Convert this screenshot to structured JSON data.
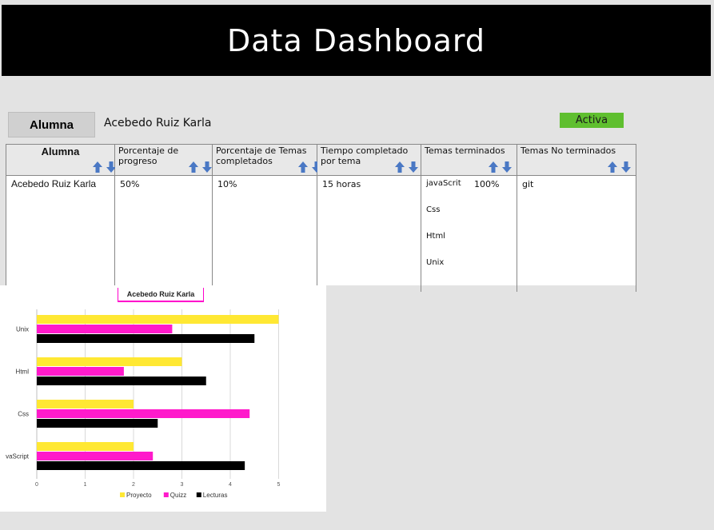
{
  "header": {
    "title": "Data Dashboard"
  },
  "student": {
    "button_label": "Alumna",
    "name": "Acebedo Ruiz Karla",
    "status": "Activa",
    "status_color": "#5fbf2f"
  },
  "table": {
    "headers": [
      "Alumna",
      "Porcentaje de progreso",
      "Porcentaje de Temas completados",
      "Tiempo completado por tema",
      "Temas terminados",
      "Temas No terminados"
    ],
    "row": {
      "alumna": "Acebedo Ruiz Karla",
      "progreso": "50%",
      "temas_completados": "10%",
      "tiempo": "15 horas",
      "temas_terminados": [
        "javaScrit",
        "Css",
        "Html",
        "Unix"
      ],
      "temas_terminados_pct": "100%",
      "temas_no_terminados": "git"
    },
    "sort_icons": [
      "arrow-up-icon",
      "arrow-down-icon"
    ],
    "sort_color": "#4a78c4"
  },
  "chart_data": {
    "type": "bar",
    "orientation": "horizontal",
    "title": "Acebedo Ruiz Karla",
    "categories": [
      "Unix",
      "Html",
      "Css",
      "vaScript"
    ],
    "series": [
      {
        "name": "Proyecto",
        "color": "#ffe833",
        "values": [
          5,
          3,
          2,
          2
        ]
      },
      {
        "name": "Quizz",
        "color": "#ff1acb",
        "values": [
          2.8,
          1.8,
          4.4,
          2.4
        ]
      },
      {
        "name": "Lecturas",
        "color": "#000000",
        "values": [
          4.5,
          3.5,
          2.5,
          4.3
        ]
      }
    ],
    "x_ticks": [
      "0",
      "1",
      "2",
      "3",
      "4",
      "5"
    ],
    "xlim": [
      0,
      6
    ],
    "grid": true,
    "legend_position": "bottom"
  }
}
